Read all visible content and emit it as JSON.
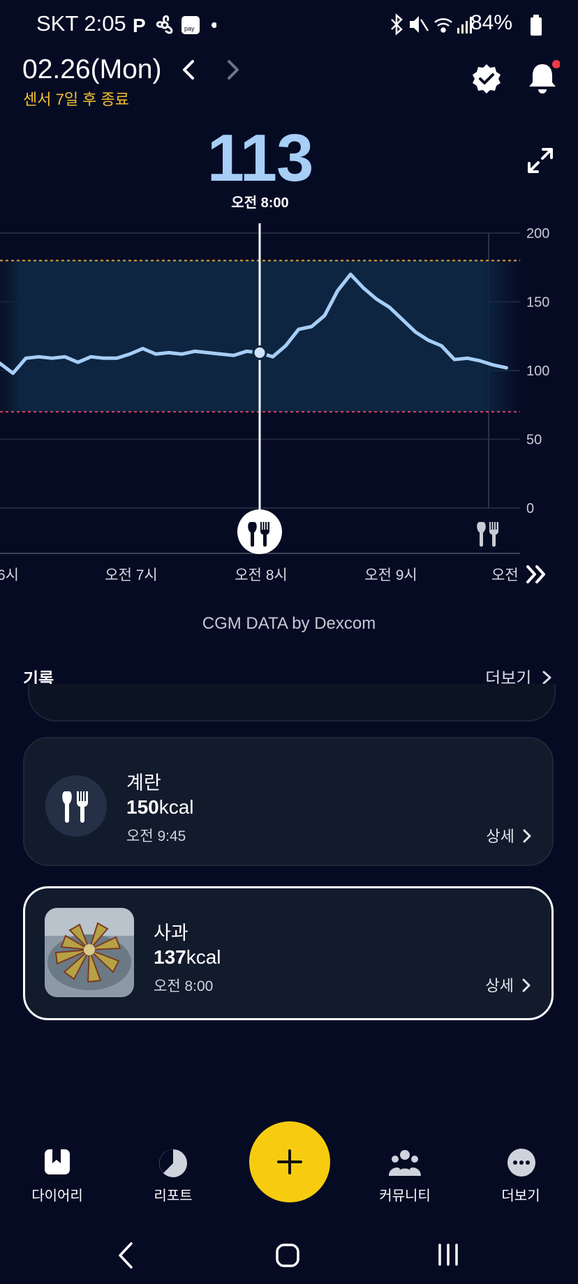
{
  "status_bar": {
    "time": "SKT 2:05",
    "battery": "84%",
    "icons": [
      "p-icon",
      "fan-icon",
      "pay-icon",
      "dot-icon",
      "bluetooth-icon",
      "mute-icon",
      "wifi-icon",
      "signal-icon",
      "battery-icon"
    ]
  },
  "header": {
    "date": "02.26(Mon)",
    "sensor_note": "센서 7일 후 종료",
    "icons": [
      "chevron-left-icon",
      "chevron-right-icon",
      "verified-icon",
      "bell-icon"
    ]
  },
  "glucose": {
    "value": "113",
    "time": "오전 8:00"
  },
  "chart_data": {
    "type": "line",
    "y_ticks": [
      "200",
      "150",
      "100",
      "50",
      "0"
    ],
    "x_ticks": [
      "6시",
      "오전 7시",
      "오전 8시",
      "오전 9시",
      "오전"
    ],
    "ylim": [
      0,
      200
    ],
    "target_range": [
      70,
      180
    ],
    "upper_line": 180,
    "lower_line": 70,
    "x_hours": [
      6.1,
      6.2,
      6.3,
      6.4,
      6.5,
      6.6,
      6.7,
      6.8,
      6.9,
      7.0,
      7.1,
      7.2,
      7.3,
      7.4,
      7.5,
      7.6,
      7.7,
      7.8,
      7.9,
      8.0,
      8.1,
      8.2,
      8.3,
      8.4,
      8.5,
      8.6,
      8.7,
      8.8,
      8.9,
      9.0,
      9.1,
      9.2,
      9.3,
      9.4,
      9.5,
      9.6,
      9.7,
      9.8,
      9.9
    ],
    "values": [
      98,
      109,
      110,
      109,
      110,
      106,
      110,
      109,
      109,
      112,
      116,
      112,
      113,
      112,
      114,
      113,
      112,
      111,
      114,
      113,
      110,
      118,
      130,
      132,
      140,
      158,
      170,
      160,
      152,
      146,
      137,
      128,
      122,
      118,
      108,
      109,
      107,
      104,
      102
    ],
    "selected": {
      "x": 8.0,
      "value": 113
    },
    "meal_markers": [
      8.0,
      9.75
    ],
    "series": [
      {
        "name": "CGM",
        "color": "#a6cef7"
      }
    ]
  },
  "cgm_credit": "CGM DATA by Dexcom",
  "records": {
    "title": "기록",
    "more": "더보기",
    "items": [
      {
        "name": "계란",
        "kcal": "150",
        "unit": "kcal",
        "time": "오전 9:45",
        "detail": "상세"
      },
      {
        "name": "사과",
        "kcal": "137",
        "unit": "kcal",
        "time": "오전 8:00",
        "detail": "상세"
      }
    ]
  },
  "bottom_nav": {
    "items": [
      {
        "label": "다이어리",
        "icon": "diary-icon"
      },
      {
        "label": "리포트",
        "icon": "report-icon"
      },
      {
        "label": "커뮤니티",
        "icon": "community-icon"
      },
      {
        "label": "더보기",
        "icon": "more-icon"
      }
    ],
    "fab_icon": "plus-icon"
  },
  "colors": {
    "background": "#060b24",
    "accent_yellow": "#f7cc10",
    "glucose_blue": "#a6cef7",
    "high_line": "#e1a33a",
    "low_line": "#d9455f"
  }
}
